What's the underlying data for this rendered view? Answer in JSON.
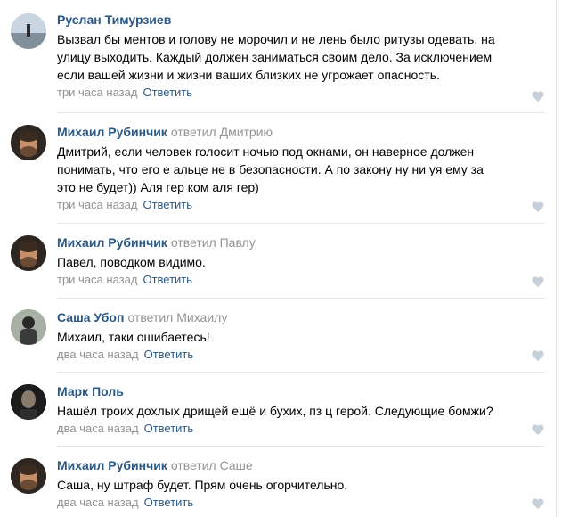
{
  "comments": [
    {
      "author": "Руслан Тимурзиев",
      "reply_to": "",
      "lines": [
        "Вызвал бы ментов и голову не морочил и не лень было ритузы одевать, на",
        "улицу выходить. Каждый должен заниматься своим дело. За исключением",
        "если вашей жизни и жизни ваших близких не угрожает опасность."
      ],
      "time": "три часа назад",
      "reply_label": "Ответить",
      "like_icon": "heart-icon"
    },
    {
      "author": "Михаил Рубинчик",
      "reply_to": "ответил Дмитрию",
      "lines": [
        "Дмитрий, если человек голосит ночью под окнами, он наверное должен",
        "понимать, что его е  альце не в безопасности. А по закону ну ни  уя ему за",
        "это не будет)) Аля гер ком аля гер)"
      ],
      "time": "три часа назад",
      "reply_label": "Ответить",
      "like_icon": "heart-icon"
    },
    {
      "author": "Михаил Рубинчик",
      "reply_to": "ответил Павлу",
      "lines": [
        "Павел, поводком видимо."
      ],
      "time": "три часа назад",
      "reply_label": "Ответить",
      "like_icon": "heart-icon"
    },
    {
      "author": "Саша Убоп",
      "reply_to": "ответил Михаилу",
      "lines": [
        "Михаил, таки ошибаетесь!"
      ],
      "time": "два часа назад",
      "reply_label": "Ответить",
      "like_icon": "heart-icon"
    },
    {
      "author": "Марк Поль",
      "reply_to": "",
      "lines": [
        "Нашёл троих дохлых дрищей ещё и бухих, пз  ц герой. Следующие бомжи?"
      ],
      "time": "два часа назад",
      "reply_label": "Ответить",
      "like_icon": "heart-icon"
    },
    {
      "author": "Михаил Рубинчик",
      "reply_to": "ответил Саше",
      "lines": [
        "Саша, ну штраф будет. Прям очень огорчительно."
      ],
      "time": "два часа назад",
      "reply_label": "Ответить",
      "like_icon": "heart-icon"
    }
  ],
  "colors": {
    "author": "#2a5885",
    "muted": "#939393",
    "separator": "#e7e8ec",
    "like": "#c5d0db"
  }
}
